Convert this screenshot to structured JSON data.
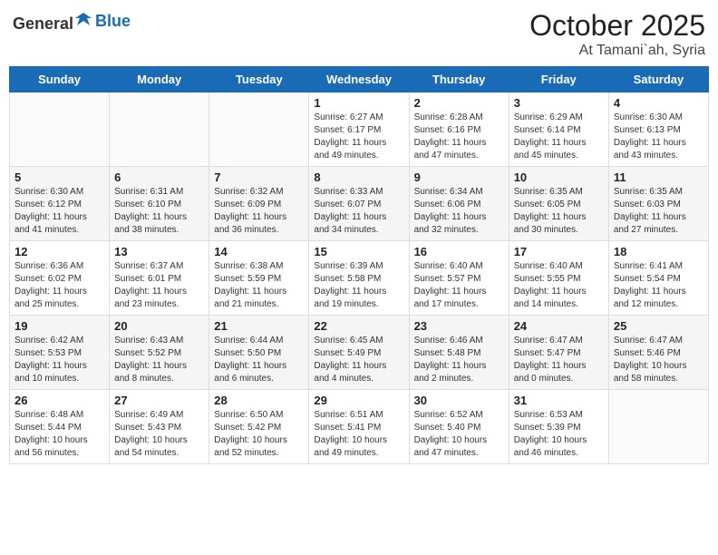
{
  "header": {
    "logo_general": "General",
    "logo_blue": "Blue",
    "month": "October 2025",
    "location": "At Tamani`ah, Syria"
  },
  "days_of_week": [
    "Sunday",
    "Monday",
    "Tuesday",
    "Wednesday",
    "Thursday",
    "Friday",
    "Saturday"
  ],
  "weeks": [
    [
      {
        "day": "",
        "info": ""
      },
      {
        "day": "",
        "info": ""
      },
      {
        "day": "",
        "info": ""
      },
      {
        "day": "1",
        "info": "Sunrise: 6:27 AM\nSunset: 6:17 PM\nDaylight: 11 hours and 49 minutes."
      },
      {
        "day": "2",
        "info": "Sunrise: 6:28 AM\nSunset: 6:16 PM\nDaylight: 11 hours and 47 minutes."
      },
      {
        "day": "3",
        "info": "Sunrise: 6:29 AM\nSunset: 6:14 PM\nDaylight: 11 hours and 45 minutes."
      },
      {
        "day": "4",
        "info": "Sunrise: 6:30 AM\nSunset: 6:13 PM\nDaylight: 11 hours and 43 minutes."
      }
    ],
    [
      {
        "day": "5",
        "info": "Sunrise: 6:30 AM\nSunset: 6:12 PM\nDaylight: 11 hours and 41 minutes."
      },
      {
        "day": "6",
        "info": "Sunrise: 6:31 AM\nSunset: 6:10 PM\nDaylight: 11 hours and 38 minutes."
      },
      {
        "day": "7",
        "info": "Sunrise: 6:32 AM\nSunset: 6:09 PM\nDaylight: 11 hours and 36 minutes."
      },
      {
        "day": "8",
        "info": "Sunrise: 6:33 AM\nSunset: 6:07 PM\nDaylight: 11 hours and 34 minutes."
      },
      {
        "day": "9",
        "info": "Sunrise: 6:34 AM\nSunset: 6:06 PM\nDaylight: 11 hours and 32 minutes."
      },
      {
        "day": "10",
        "info": "Sunrise: 6:35 AM\nSunset: 6:05 PM\nDaylight: 11 hours and 30 minutes."
      },
      {
        "day": "11",
        "info": "Sunrise: 6:35 AM\nSunset: 6:03 PM\nDaylight: 11 hours and 27 minutes."
      }
    ],
    [
      {
        "day": "12",
        "info": "Sunrise: 6:36 AM\nSunset: 6:02 PM\nDaylight: 11 hours and 25 minutes."
      },
      {
        "day": "13",
        "info": "Sunrise: 6:37 AM\nSunset: 6:01 PM\nDaylight: 11 hours and 23 minutes."
      },
      {
        "day": "14",
        "info": "Sunrise: 6:38 AM\nSunset: 5:59 PM\nDaylight: 11 hours and 21 minutes."
      },
      {
        "day": "15",
        "info": "Sunrise: 6:39 AM\nSunset: 5:58 PM\nDaylight: 11 hours and 19 minutes."
      },
      {
        "day": "16",
        "info": "Sunrise: 6:40 AM\nSunset: 5:57 PM\nDaylight: 11 hours and 17 minutes."
      },
      {
        "day": "17",
        "info": "Sunrise: 6:40 AM\nSunset: 5:55 PM\nDaylight: 11 hours and 14 minutes."
      },
      {
        "day": "18",
        "info": "Sunrise: 6:41 AM\nSunset: 5:54 PM\nDaylight: 11 hours and 12 minutes."
      }
    ],
    [
      {
        "day": "19",
        "info": "Sunrise: 6:42 AM\nSunset: 5:53 PM\nDaylight: 11 hours and 10 minutes."
      },
      {
        "day": "20",
        "info": "Sunrise: 6:43 AM\nSunset: 5:52 PM\nDaylight: 11 hours and 8 minutes."
      },
      {
        "day": "21",
        "info": "Sunrise: 6:44 AM\nSunset: 5:50 PM\nDaylight: 11 hours and 6 minutes."
      },
      {
        "day": "22",
        "info": "Sunrise: 6:45 AM\nSunset: 5:49 PM\nDaylight: 11 hours and 4 minutes."
      },
      {
        "day": "23",
        "info": "Sunrise: 6:46 AM\nSunset: 5:48 PM\nDaylight: 11 hours and 2 minutes."
      },
      {
        "day": "24",
        "info": "Sunrise: 6:47 AM\nSunset: 5:47 PM\nDaylight: 11 hours and 0 minutes."
      },
      {
        "day": "25",
        "info": "Sunrise: 6:47 AM\nSunset: 5:46 PM\nDaylight: 10 hours and 58 minutes."
      }
    ],
    [
      {
        "day": "26",
        "info": "Sunrise: 6:48 AM\nSunset: 5:44 PM\nDaylight: 10 hours and 56 minutes."
      },
      {
        "day": "27",
        "info": "Sunrise: 6:49 AM\nSunset: 5:43 PM\nDaylight: 10 hours and 54 minutes."
      },
      {
        "day": "28",
        "info": "Sunrise: 6:50 AM\nSunset: 5:42 PM\nDaylight: 10 hours and 52 minutes."
      },
      {
        "day": "29",
        "info": "Sunrise: 6:51 AM\nSunset: 5:41 PM\nDaylight: 10 hours and 49 minutes."
      },
      {
        "day": "30",
        "info": "Sunrise: 6:52 AM\nSunset: 5:40 PM\nDaylight: 10 hours and 47 minutes."
      },
      {
        "day": "31",
        "info": "Sunrise: 6:53 AM\nSunset: 5:39 PM\nDaylight: 10 hours and 46 minutes."
      },
      {
        "day": "",
        "info": ""
      }
    ]
  ]
}
